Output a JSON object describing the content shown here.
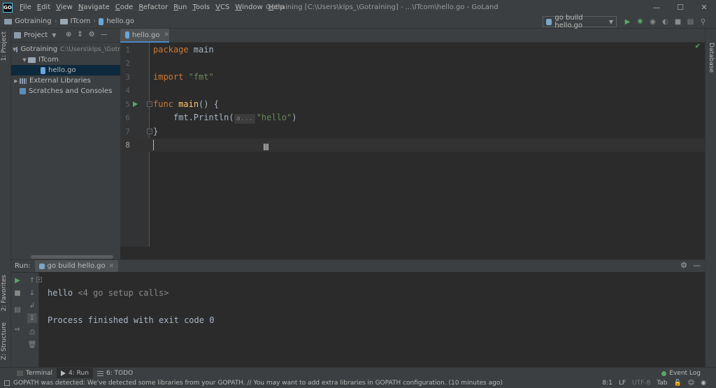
{
  "app": {
    "logo_text": "GO",
    "window_title": "Gotraining [C:\\Users\\klps_\\Gotraining] - ...\\ITcom\\hello.go - GoLand"
  },
  "menu": [
    {
      "first": "F",
      "rest": "ile"
    },
    {
      "first": "E",
      "rest": "dit"
    },
    {
      "first": "V",
      "rest": "iew"
    },
    {
      "first": "N",
      "rest": "avigate"
    },
    {
      "first": "C",
      "rest": "ode"
    },
    {
      "first": "R",
      "rest": "efactor"
    },
    {
      "first": "R",
      "rest": "un"
    },
    {
      "first": "T",
      "rest": "ools"
    },
    {
      "first": "V",
      "rest": "CS"
    },
    {
      "first": "W",
      "rest": "indow"
    },
    {
      "first": "H",
      "rest": "elp"
    }
  ],
  "breadcrumb": {
    "project": "Gotraining",
    "folder": "ITcom",
    "file": "hello.go"
  },
  "run_config": {
    "label": "go build hello.go"
  },
  "side_tabs": {
    "project": "1: Project",
    "favorites": "2: Favorites",
    "structure": "Z: Structure",
    "database": "Database"
  },
  "project_panel": {
    "title": "Project",
    "tree": {
      "root": "Gotraining",
      "root_path": "C:\\Users\\klps_\\Gotr",
      "folder": "ITcom",
      "file": "hello.go",
      "external": "External Libraries",
      "scratches": "Scratches and Consoles"
    }
  },
  "editor": {
    "tab_label": "hello.go",
    "line_numbers": [
      "1",
      "2",
      "3",
      "4",
      "5",
      "6",
      "7",
      "8"
    ],
    "code": {
      "l1_kw": "package",
      "l1_rest": " main",
      "l3_kw": "import",
      "l3_str": "\"fmt\"",
      "l5_kw": "func",
      "l5_fn": "main",
      "l5_rest": "() {",
      "l6_pre": "    fmt.Println(",
      "l6_hint": "a...",
      "l6_str": "\"hello\"",
      "l6_post": ")",
      "l7": "}"
    }
  },
  "run_panel": {
    "label": "Run:",
    "tab": "go build hello.go",
    "console": {
      "folded": "<4 go setup calls>",
      "output": "hello",
      "exit": "Process finished with exit code 0"
    }
  },
  "bottom_tabs": {
    "terminal": "Terminal",
    "run": "4: Run",
    "todo": "6: TODO",
    "event_log": "Event Log"
  },
  "status": {
    "message": "GOPATH was detected: We've detected some libraries from your GOPATH. // You may want to add extra libraries in GOPATH configuration. (10 minutes ago)",
    "position": "8:1",
    "line_sep": "LF",
    "encoding": "UTF-8",
    "indent": "Tab"
  },
  "colors": {
    "background": "#2b2b2b",
    "panel": "#3c3f41",
    "keyword": "#cc7832",
    "string": "#6a8759",
    "function": "#ffc66d",
    "run_green": "#59a869",
    "selection": "#0d293e"
  }
}
